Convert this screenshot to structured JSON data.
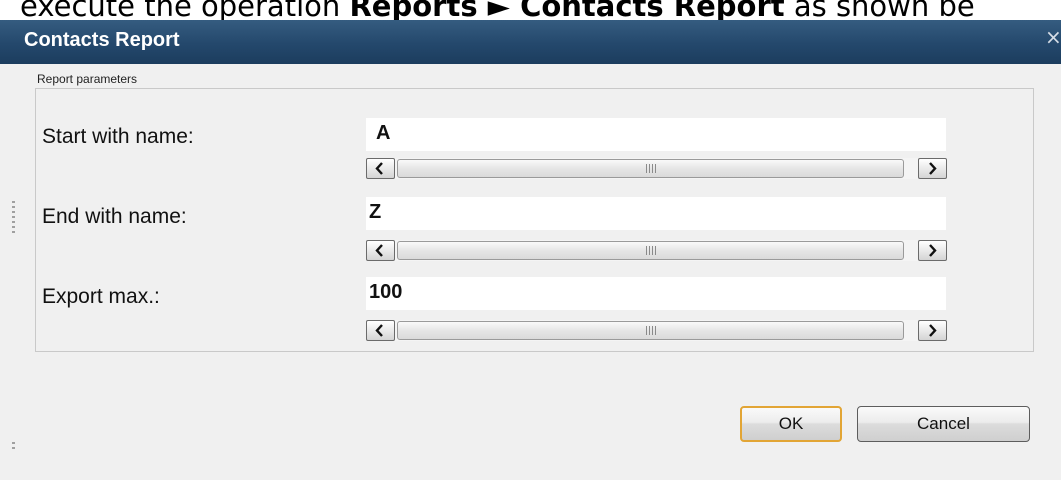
{
  "caption": {
    "prefix": "execute the operation ",
    "menu_path": "Reports ► Contacts Report",
    "suffix": " as shown be"
  },
  "dialog": {
    "title": "Contacts Report",
    "close_glyph": "×",
    "group_label": "Report parameters",
    "fields": [
      {
        "label": "Start with name:",
        "value": "A"
      },
      {
        "label": "End with name:",
        "value": "Z"
      },
      {
        "label": "Export max.:",
        "value": "100"
      }
    ],
    "ok_label": "OK",
    "cancel_label": "Cancel"
  },
  "colors": {
    "titlebar": "#24486c",
    "title_text": "#ffffff",
    "dialog_bg": "#f0f0f0",
    "ok_border": "#e2a535"
  },
  "icons": {
    "scroll_left": "chevron-left-icon",
    "scroll_right": "chevron-right-icon",
    "close": "close-icon"
  }
}
